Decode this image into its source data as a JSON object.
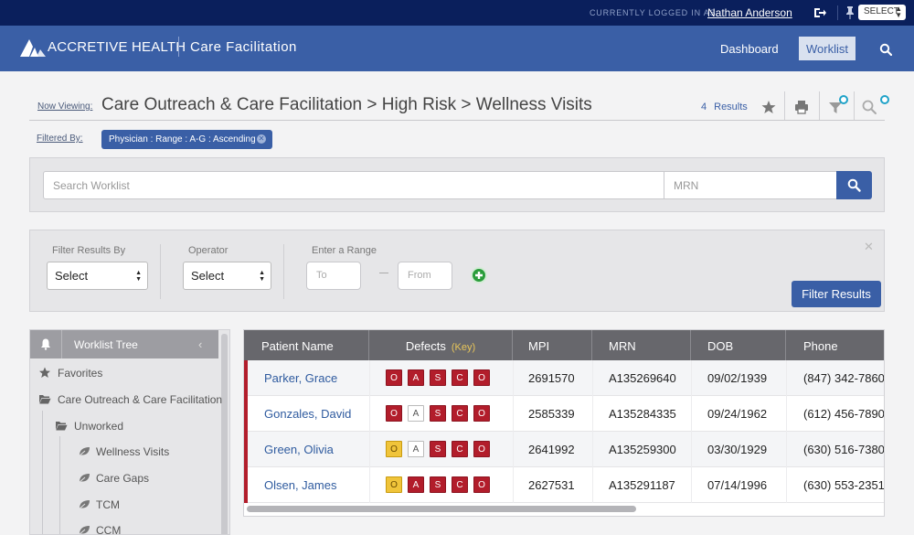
{
  "topbar": {
    "logged_in_label": "CURRENTLY LOGGED IN AS:",
    "user_name": "Nathan Anderson",
    "select_label": "SELECT"
  },
  "header": {
    "brand": "ACCRETIVE HEALTH",
    "app_title": "Care Facilitation",
    "nav": {
      "dashboard": "Dashboard",
      "worklist": "Worklist"
    }
  },
  "view": {
    "now_viewing_label": "Now Viewing:",
    "breadcrumb": "Care Outreach & Care Facilitation > High Risk > Wellness Visits",
    "results_count": "4",
    "results_label": "Results",
    "filtered_by_label": "Filtered By:",
    "filter_chip": "Physician : Range : A-G : Ascending"
  },
  "search": {
    "worklist_placeholder": "Search Worklist",
    "mrn_placeholder": "MRN"
  },
  "filter": {
    "filter_by_label": "Filter Results By",
    "filter_by_value": "Select",
    "operator_label": "Operator",
    "operator_value": "Select",
    "range_label": "Enter a Range",
    "to_placeholder": "To",
    "from_placeholder": "From",
    "button": "Filter Results"
  },
  "tree": {
    "title": "Worklist Tree",
    "items": {
      "favorites": "Favorites",
      "care_outreach": "Care Outreach & Care Facilitation",
      "unworked": "Unworked",
      "wellness": "Wellness Visits",
      "care_gaps": "Care Gaps",
      "tcm": "TCM",
      "ccm": "CCM"
    }
  },
  "table": {
    "headers": {
      "name": "Patient Name",
      "defects": "Defects",
      "key": "(Key)",
      "mpi": "MPI",
      "mrn": "MRN",
      "dob": "DOB",
      "phone": "Phone"
    },
    "rows": [
      {
        "name": "Parker, Grace",
        "mpi": "2691570",
        "mrn": "A135269640",
        "dob": "09/02/1939",
        "phone": "(847) 342-7860",
        "defects": [
          {
            "letter": "O",
            "status": "red"
          },
          {
            "letter": "A",
            "status": "red"
          },
          {
            "letter": "S",
            "status": "red"
          },
          {
            "letter": "C",
            "status": "red"
          },
          {
            "letter": "O",
            "status": "red"
          }
        ]
      },
      {
        "name": "Gonzales, David",
        "mpi": "2585339",
        "mrn": "A135284335",
        "dob": "09/24/1962",
        "phone": "(612) 456-7890",
        "defects": [
          {
            "letter": "O",
            "status": "red"
          },
          {
            "letter": "A",
            "status": "white"
          },
          {
            "letter": "S",
            "status": "red"
          },
          {
            "letter": "C",
            "status": "red"
          },
          {
            "letter": "O",
            "status": "red"
          }
        ]
      },
      {
        "name": "Green, Olivia",
        "mpi": "2641992",
        "mrn": "A135259300",
        "dob": "03/30/1929",
        "phone": "(630) 516-7380",
        "defects": [
          {
            "letter": "O",
            "status": "yellow"
          },
          {
            "letter": "A",
            "status": "white"
          },
          {
            "letter": "S",
            "status": "red"
          },
          {
            "letter": "C",
            "status": "red"
          },
          {
            "letter": "O",
            "status": "red"
          }
        ]
      },
      {
        "name": "Olsen, James",
        "mpi": "2627531",
        "mrn": "A135291187",
        "dob": "07/14/1996",
        "phone": "(630) 553-2351",
        "defects": [
          {
            "letter": "O",
            "status": "yellow"
          },
          {
            "letter": "A",
            "status": "red"
          },
          {
            "letter": "S",
            "status": "red"
          },
          {
            "letter": "C",
            "status": "red"
          },
          {
            "letter": "O",
            "status": "red"
          }
        ]
      }
    ]
  },
  "icons": {
    "logout": "logout-icon",
    "pin": "pin-icon",
    "search": "search-icon",
    "star": "star-icon",
    "print": "print-icon",
    "filter": "filter-icon",
    "bell": "bell-icon",
    "folder": "folder-icon",
    "leaf": "leaf-icon",
    "plus": "plus-icon"
  },
  "colors": {
    "topbar": "#0a1f5c",
    "header": "#3a5fa6",
    "accent": "#3a5fa6",
    "defect_red": "#b21d2b",
    "defect_yellow": "#f0c43a",
    "table_header": "#67676c"
  }
}
